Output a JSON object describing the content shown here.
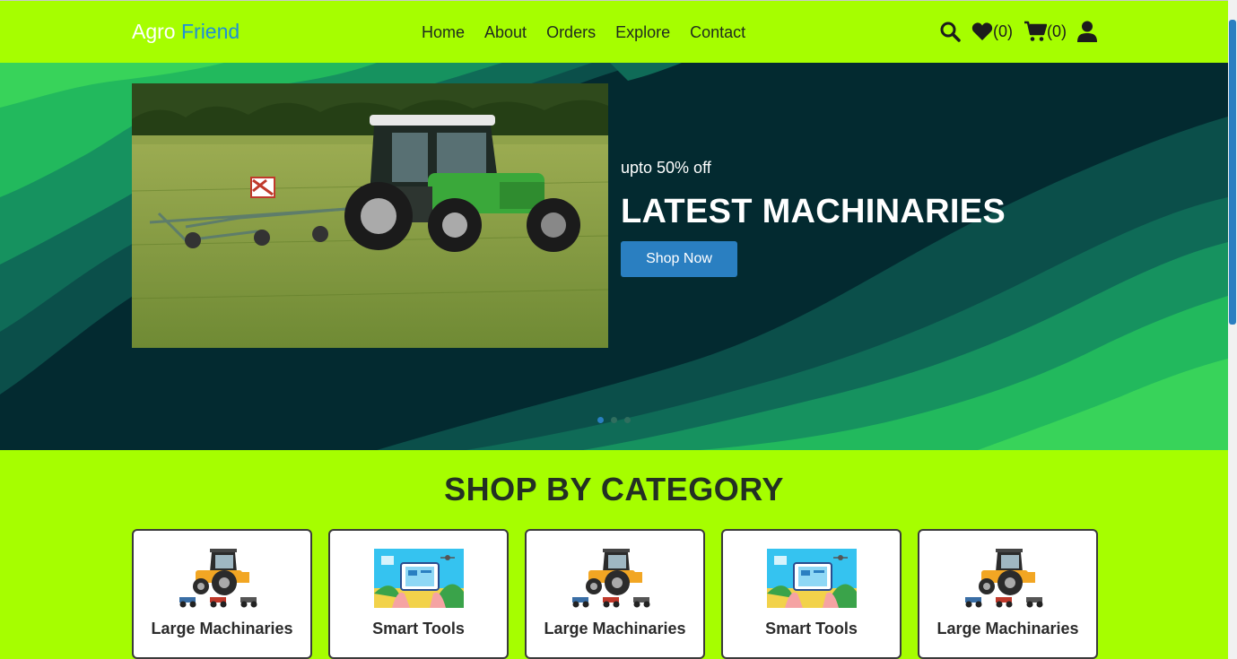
{
  "brand": {
    "part1": "Agro",
    "part2": "Friend"
  },
  "nav": {
    "links": [
      "Home",
      "About",
      "Orders",
      "Explore",
      "Contact"
    ]
  },
  "icons": {
    "search": "search-icon",
    "wishlist": "heart-icon",
    "cart": "cart-icon",
    "user": "user-icon"
  },
  "counts": {
    "wishlist": "(0)",
    "cart": "(0)"
  },
  "hero": {
    "offer": "upto 50% off",
    "title": "LATEST MACHINARIES",
    "button": "Shop Now",
    "slides": 3,
    "active_slide": 1
  },
  "category": {
    "title": "SHOP BY CATEGORY",
    "items": [
      {
        "label": "Large Machinaries",
        "image": "tractor"
      },
      {
        "label": "Smart Tools",
        "image": "smart-farm"
      },
      {
        "label": "Large Machinaries",
        "image": "tractor"
      },
      {
        "label": "Smart Tools",
        "image": "smart-farm"
      },
      {
        "label": "Large Machinaries",
        "image": "tractor"
      }
    ]
  },
  "colors": {
    "nav_bg": "#a6fe00",
    "brand_accent": "#1e8fd6",
    "button": "#2a7fc1",
    "hero_dark": "#032a30",
    "hero_green": "#2fd760"
  }
}
